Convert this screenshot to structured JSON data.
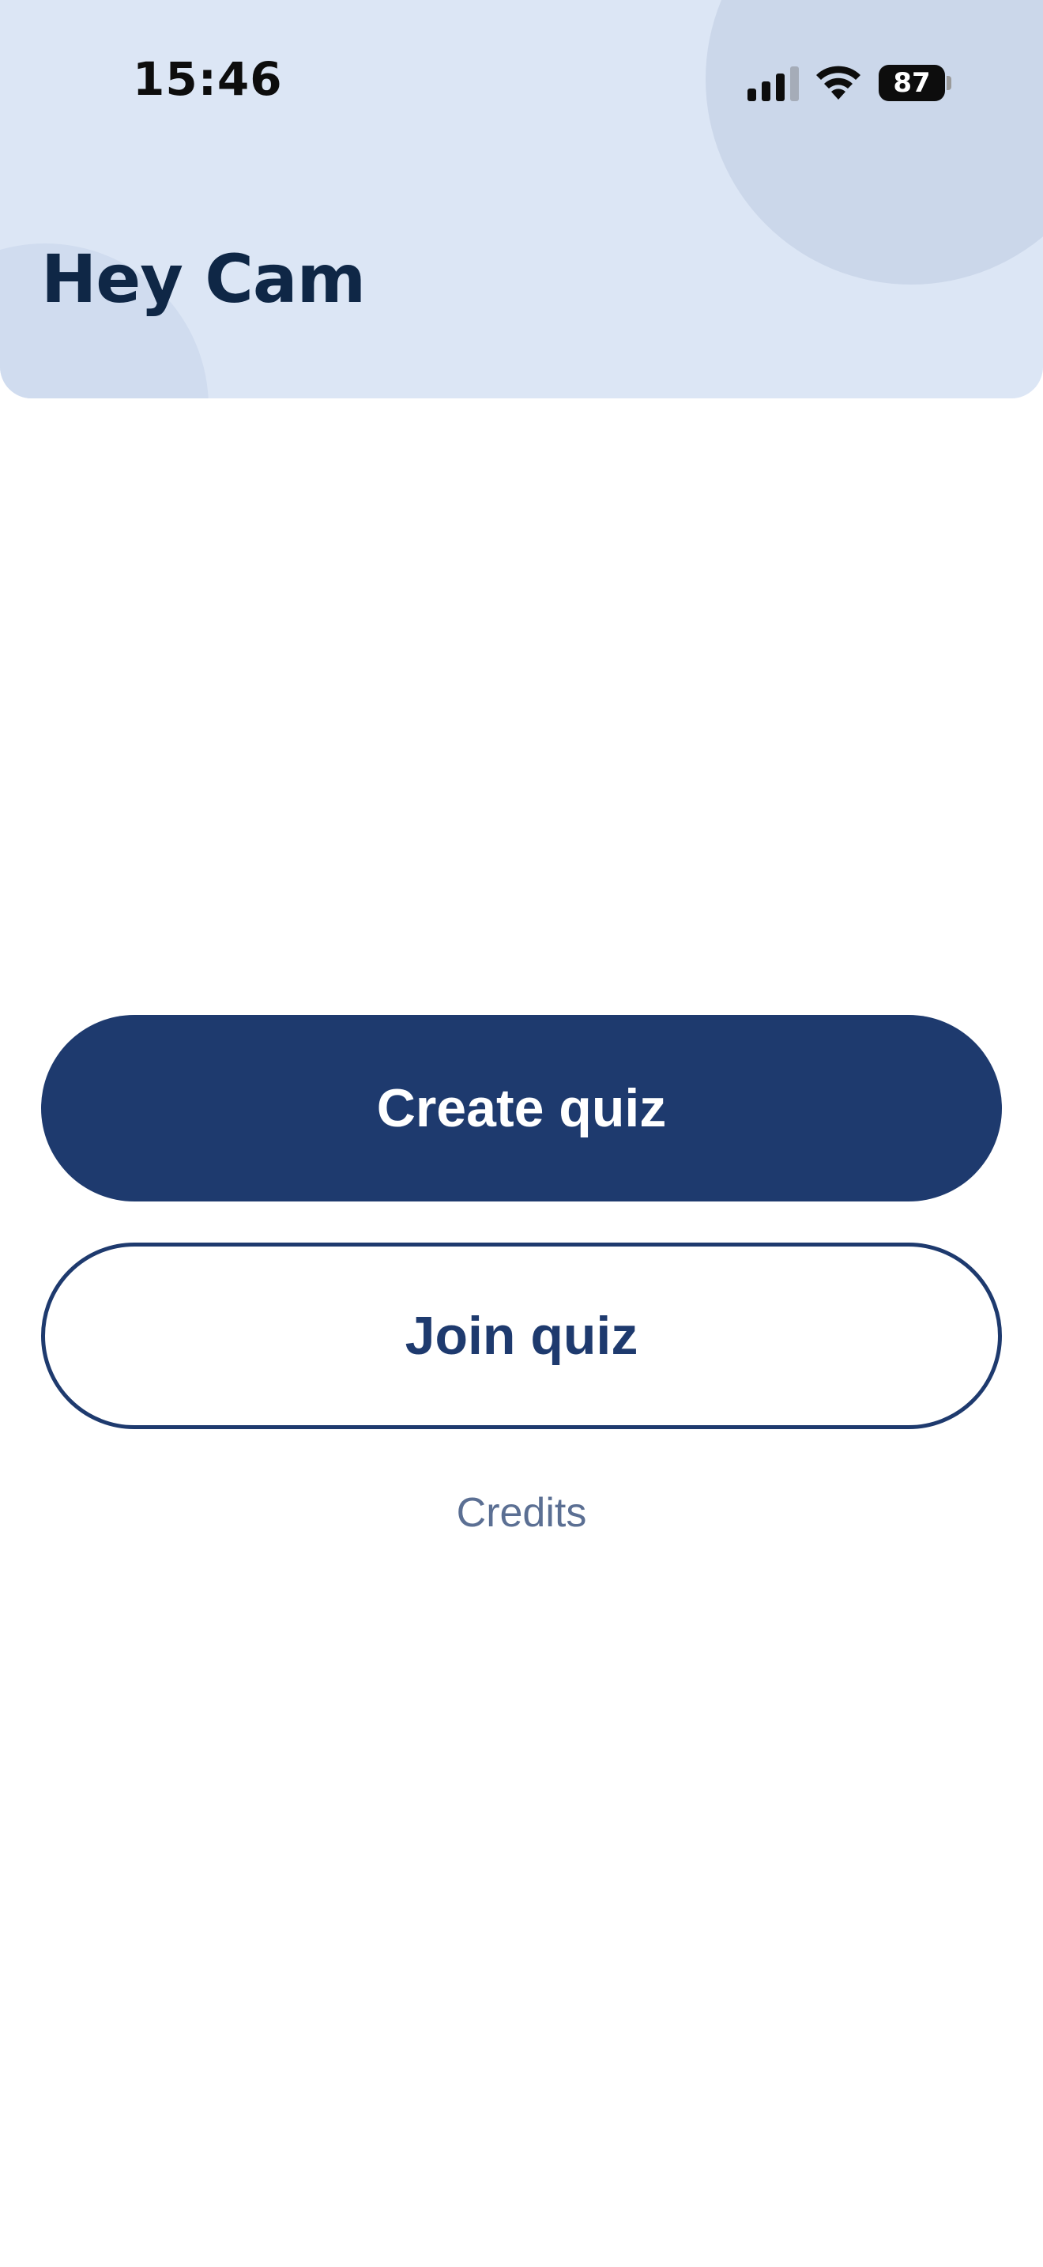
{
  "status_bar": {
    "time": "15:46",
    "battery_level": "87",
    "signal_icon": "cellular-signal-icon",
    "wifi_icon": "wifi-icon"
  },
  "header": {
    "greeting": "Hey Cam"
  },
  "actions": {
    "create_label": "Create quiz",
    "join_label": "Join quiz",
    "credits_label": "Credits"
  },
  "colors": {
    "primary": "#1e3a6e",
    "header_background": "#dce6f5",
    "greeting_text": "#0f2746",
    "credits_text": "#5b6f93"
  }
}
